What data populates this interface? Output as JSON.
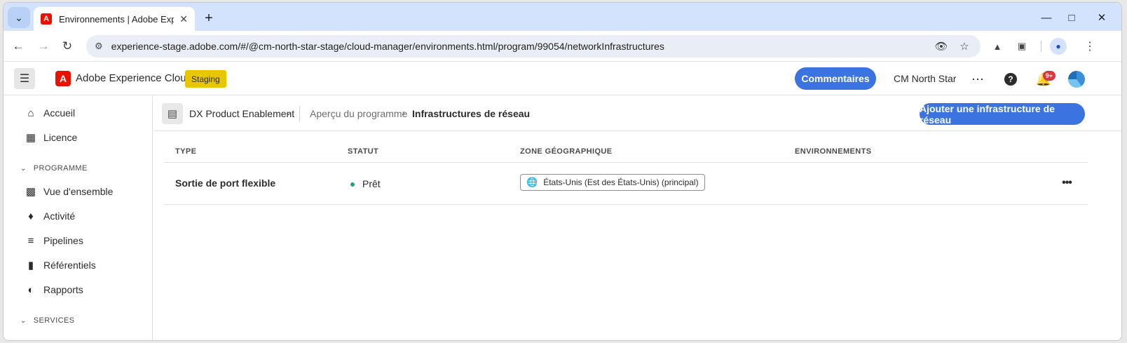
{
  "browser": {
    "tab_title": "Environnements | Adobe Experi",
    "url": "experience-stage.adobe.com/#/@cm-north-star-stage/cloud-manager/environments.html/program/99054/networkInfrastructures",
    "icons": [
      "tab-search-icon",
      "adobe-favicon",
      "close-icon",
      "plus-icon",
      "minimize-icon",
      "maximize-icon",
      "close-window-icon",
      "back-icon",
      "forward-icon",
      "reload-icon",
      "site-settings-icon",
      "eye-off-icon",
      "star-icon",
      "extension-icon",
      "puzzle-icon",
      "profile-icon"
    ]
  },
  "header": {
    "brand": "Adobe Experience Cloud",
    "env_badge": "Staging",
    "feedback_label": "Commentaires",
    "org_name": "CM North Star",
    "notification_count": "9+"
  },
  "sidebar": {
    "items_top": [
      {
        "label": "Accueil",
        "icon": "home-icon"
      },
      {
        "label": "Licence",
        "icon": "license-icon"
      }
    ],
    "section_program": "PROGRAMME",
    "items_program": [
      {
        "label": "Vue d'ensemble",
        "icon": "overview-icon"
      },
      {
        "label": "Activité",
        "icon": "bell-icon"
      },
      {
        "label": "Pipelines",
        "icon": "pipeline-icon"
      },
      {
        "label": "Référentiels",
        "icon": "folder-icon"
      },
      {
        "label": "Rapports",
        "icon": "reports-icon"
      }
    ],
    "section_services": "SERVICES"
  },
  "main": {
    "program_name": "DX Product Enablement",
    "breadcrumb_parent": "Aperçu du programme",
    "breadcrumb_current": "Infrastructures de réseau",
    "add_button": "Ajouter une infrastructure de réseau",
    "table": {
      "columns": [
        "TYPE",
        "STATUT",
        "ZONE GÉOGRAPHIQUE",
        "ENVIRONNEMENTS"
      ],
      "rows": [
        {
          "type": "Sortie de port flexible",
          "status": "Prêt",
          "region": "États-Unis (Est des États-Unis) (principal)",
          "environments": ""
        }
      ]
    },
    "colors": {
      "accent": "#3b74e0",
      "status_ready": "#2d9d78",
      "staging": "#e8c600",
      "adobe_red": "#eb1000"
    }
  }
}
